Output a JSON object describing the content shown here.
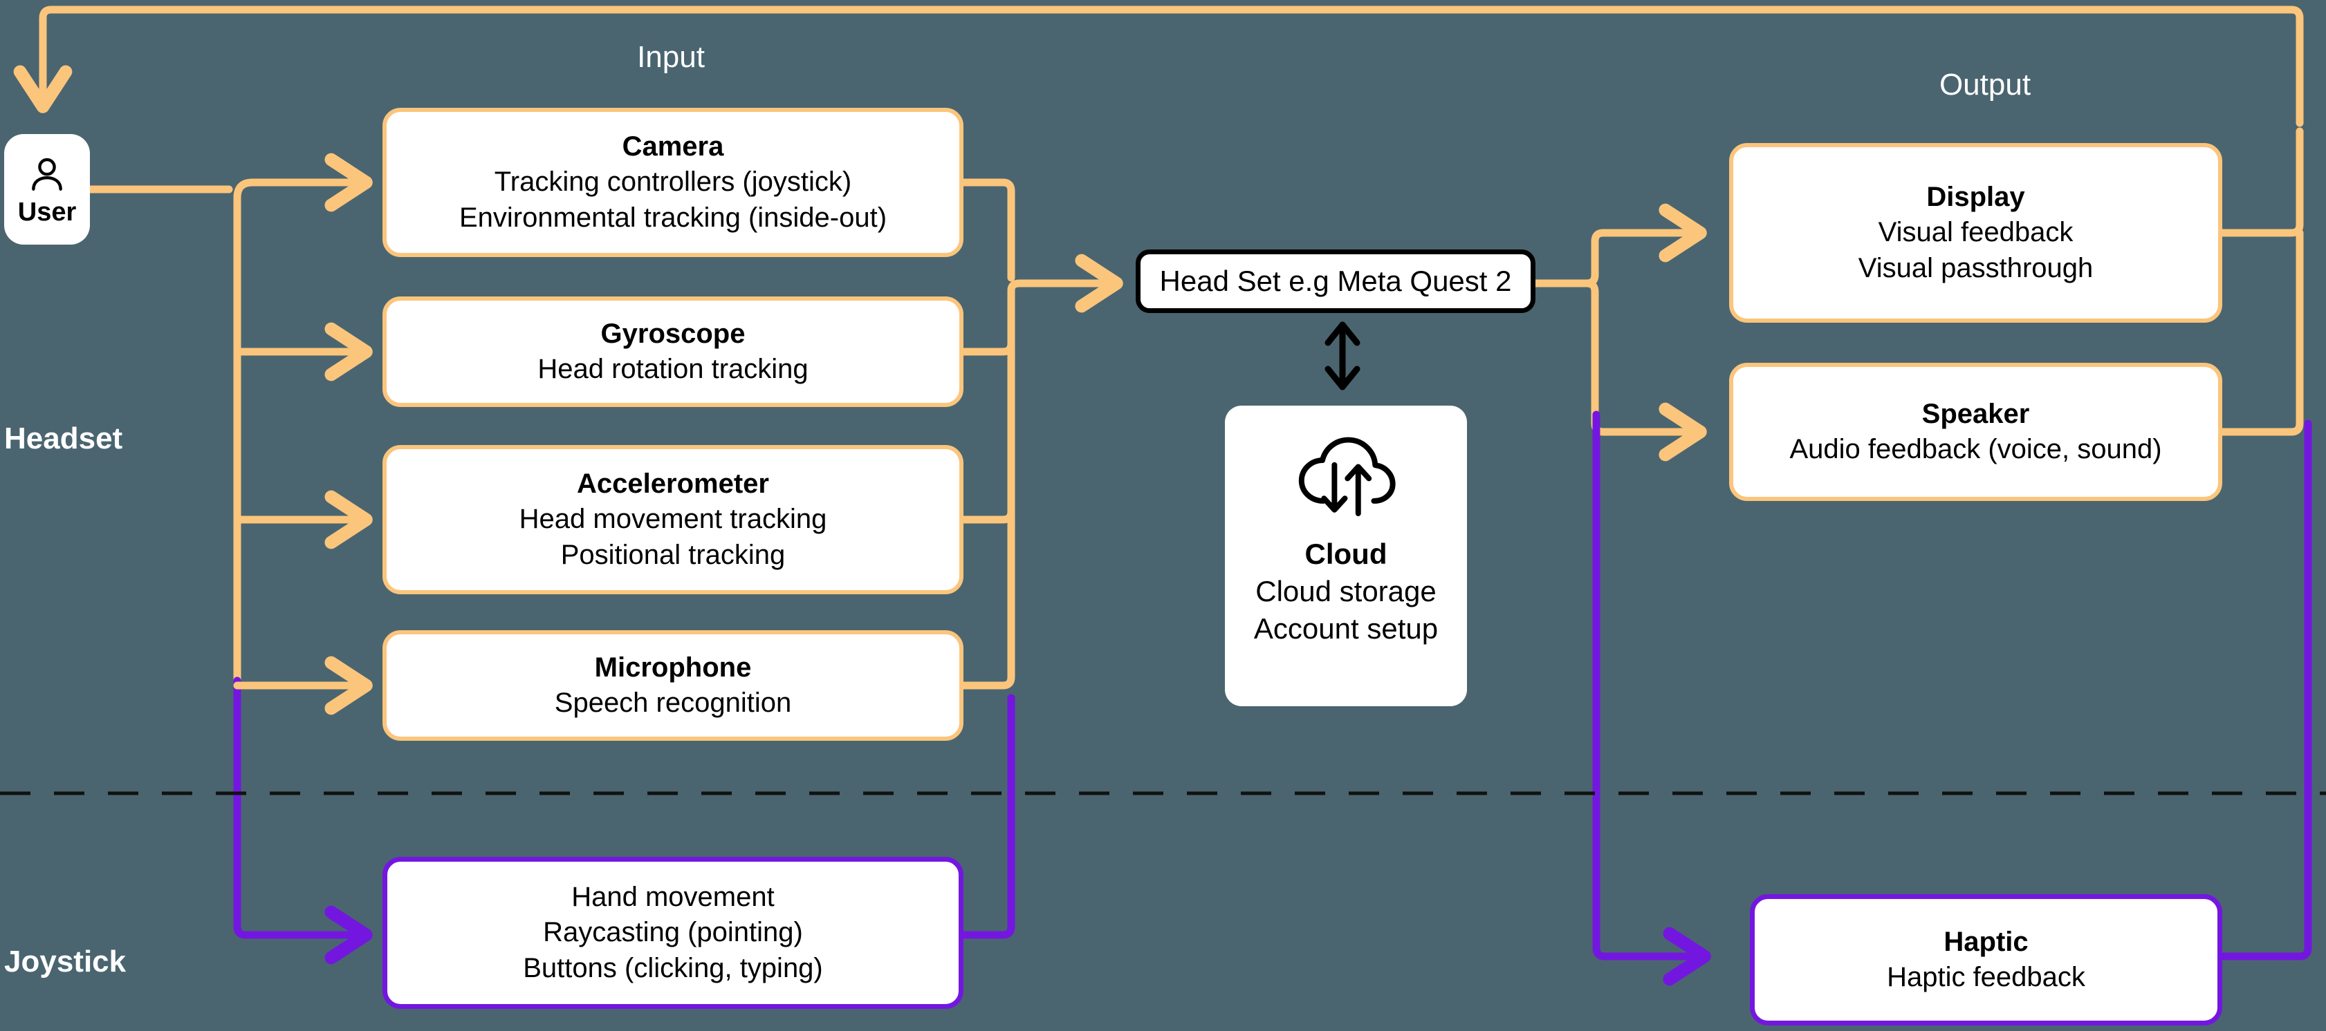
{
  "colors": {
    "background": "#4a6570",
    "orange": "#fbc57c",
    "purple": "#7317e0",
    "black": "#000000",
    "node_fill": "#ffffff",
    "label_text": "#ffffff"
  },
  "sections": {
    "input_title": "Input",
    "output_title": "Output"
  },
  "side_labels": {
    "headset": "Headset",
    "joystick": "Joystick"
  },
  "user": {
    "icon": "person-icon",
    "label": "User"
  },
  "input_nodes": [
    {
      "id": "camera",
      "title": "Camera",
      "lines": [
        "Tracking controllers (joystick)",
        "Environmental tracking (inside-out)"
      ],
      "border_color": "#fbc57c"
    },
    {
      "id": "gyroscope",
      "title": "Gyroscope",
      "lines": [
        "Head rotation tracking"
      ],
      "border_color": "#fbc57c"
    },
    {
      "id": "accelerometer",
      "title": "Accelerometer",
      "lines": [
        "Head movement tracking",
        "Positional tracking"
      ],
      "border_color": "#fbc57c"
    },
    {
      "id": "microphone",
      "title": "Microphone",
      "lines": [
        "Speech recognition"
      ],
      "border_color": "#fbc57c"
    },
    {
      "id": "joystick-input",
      "title": "",
      "lines": [
        "Hand movement",
        "Raycasting (pointing)",
        "Buttons (clicking, typing)"
      ],
      "border_color": "#7317e0"
    }
  ],
  "center": {
    "headset": {
      "label": "Head Set e.g Meta Quest 2",
      "border_color": "#000000"
    },
    "link_icon": "double-arrow-vertical-icon",
    "cloud": {
      "icon": "cloud-sync-icon",
      "title": "Cloud",
      "lines": [
        "Cloud storage",
        "Account setup"
      ]
    }
  },
  "output_nodes": [
    {
      "id": "display",
      "title": "Display",
      "lines": [
        "Visual feedback",
        "Visual passthrough"
      ],
      "border_color": "#fbc57c"
    },
    {
      "id": "speaker",
      "title": "Speaker",
      "lines": [
        "Audio feedback (voice, sound)"
      ],
      "border_color": "#fbc57c"
    },
    {
      "id": "haptic",
      "title": "Haptic",
      "lines": [
        "Haptic feedback"
      ],
      "border_color": "#7317e0"
    }
  ]
}
